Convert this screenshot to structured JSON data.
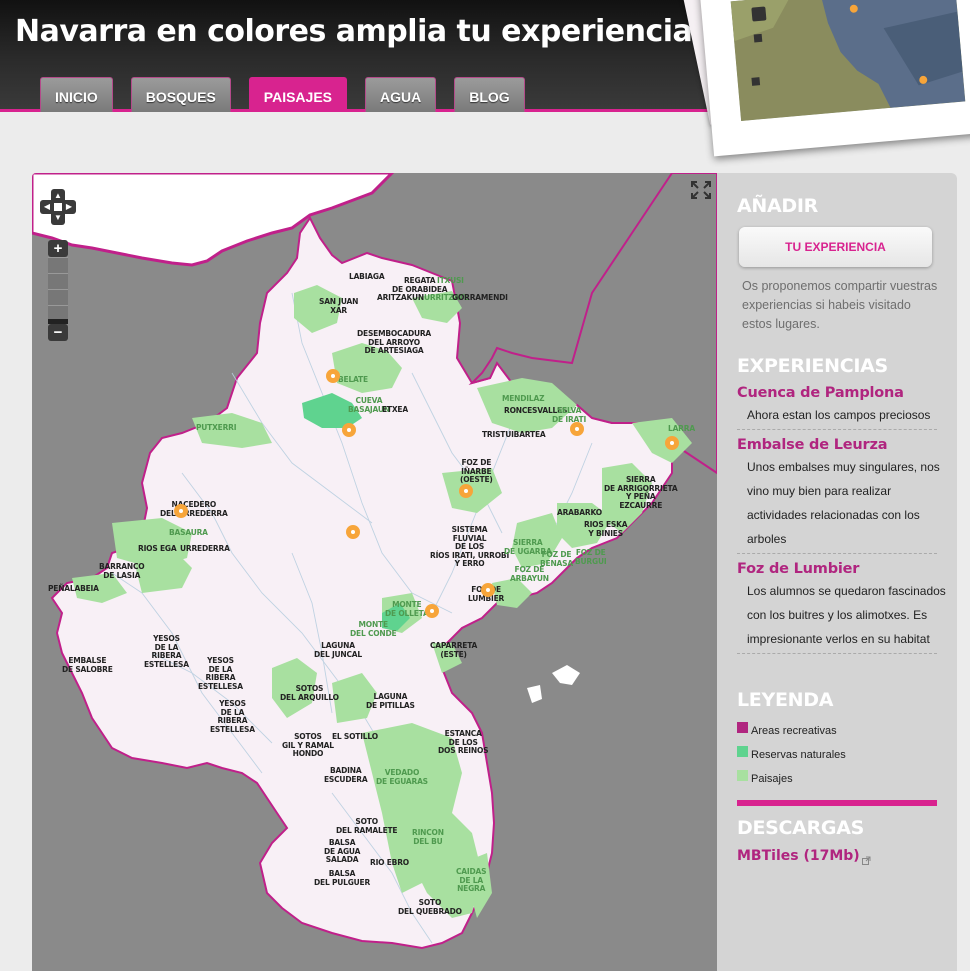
{
  "site": {
    "title": "Navarra en colores amplia tu experiencia"
  },
  "nav": {
    "tabs": [
      {
        "label": "INICIO",
        "active": false
      },
      {
        "label": "BOSQUES",
        "active": false
      },
      {
        "label": "PAISAJES",
        "active": true
      },
      {
        "label": "AGUA",
        "active": false
      },
      {
        "label": "BLOG",
        "active": false
      }
    ]
  },
  "map": {
    "controls": {
      "zoom_in": "+",
      "zoom_out": "−"
    },
    "labels": [
      "LABIAGA",
      "REGATA\nDE ORABIDEA",
      "ITXUSI",
      "ARITZAKUN",
      "URRITZATE",
      "GORRAMENDI",
      "SAN JUAN\nXAR",
      "DESEMBOCADURA\nDEL ARROYO\nDE ARTESIAGA",
      "BELATE",
      "CUEVA\nBASAJAUN",
      "ETXEA",
      "PUTXERRI",
      "MENDILAZ",
      "RONCESVALLES",
      "SELVA\nDE IRATI",
      "TRISTUIBARTEA",
      "LARRA",
      "FOZ DE\nIÑARBE\n(OESTE)",
      "SIERRA\nDE ARRIGORRIETA\nY PEÑA\nEZCAURRE",
      "ARABARKO",
      "NACEDERO\nDEL URREDERRA",
      "BASAURA",
      "RIOS EGA",
      "URREDERRA",
      "SISTEMA\nFLUVIAL\nDE LOS\nRÍOS IRATI, URROBI\nY ERRO",
      "RIOS ESKA\nY BINIES",
      "SIERRA\nDE UGARRA",
      "FOZ DE\nARBAYUN",
      "FOZ DE\nBENASA",
      "FOZ DE\nBURGUI",
      "BARRANCO\nDE LASIA",
      "PEÑALABEIA",
      "FOZ DE\nLUMBIER",
      "MONTE\nDE OLLETA",
      "MONTE\nDEL CONDE",
      "LAGUNA\nDEL JUNCAL",
      "CAPARRETA\n(ESTE)",
      "YESOS\nDE LA\nRIBERA\nESTELLESA",
      "EMBALSE\nDE SALOBRE",
      "YESOS\nDE LA\nRIBERA\nESTELLESA",
      "SOTOS\nDEL ARQUILLO",
      "LAGUNA\nDE PITILLAS",
      "YESOS\nDE LA\nRIBERA\nESTELLESA",
      "SOTOS\nGIL Y RAMAL\nHONDO",
      "EL SOTILLO",
      "ESTANCA\nDE LOS\nDOS REINOS",
      "BADINA\nESCUDERA",
      "VEDADO\nDE EGUARAS",
      "SOTO\nDEL RAMALETE",
      "RINCON\nDEL BU",
      "BALSA\nDE AGUA\nSALADA",
      "RIO EBRO",
      "BALSA\nDEL PULGUER",
      "CAIDAS\nDE LA\nNEGRA",
      "SOTO\nDEL QUEBRADO"
    ]
  },
  "sidebar": {
    "add_heading": "AÑADIR",
    "add_button": "TU EXPERIENCIA",
    "intro": "Os proponemos compartir vuestras experiencias si habeis visitado estos lugares.",
    "experiences_heading": "EXPERIENCIAS",
    "experiences": [
      {
        "title": "Cuenca de Pamplona",
        "text": "Ahora estan los campos preciosos"
      },
      {
        "title": "Embalse de Leurza",
        "text": "Unos embalses muy singulares, nos vino muy bien para realizar actividades relacionadas con los arboles"
      },
      {
        "title": "Foz de Lumbier",
        "text": "Los alumnos se quedaron fascinados con los buitres y los alimotxes. Es impresionante verlos en su habitat"
      }
    ],
    "legend_heading": "LEYENDA",
    "legend": [
      {
        "label": "Areas recreativas",
        "color": "#b0257f"
      },
      {
        "label": "Reservas naturales",
        "color": "#5fd38f"
      },
      {
        "label": "Paisajes",
        "color": "#a8e0a0"
      }
    ],
    "downloads_heading": "DESCARGAS",
    "download_link": "MBTiles (17Mb)"
  },
  "colors": {
    "accent": "#d8238f",
    "region": "#f8f0f6",
    "landscape": "#a8e0a0",
    "reserve": "#5fd38f",
    "marker": "#f7a53a"
  }
}
